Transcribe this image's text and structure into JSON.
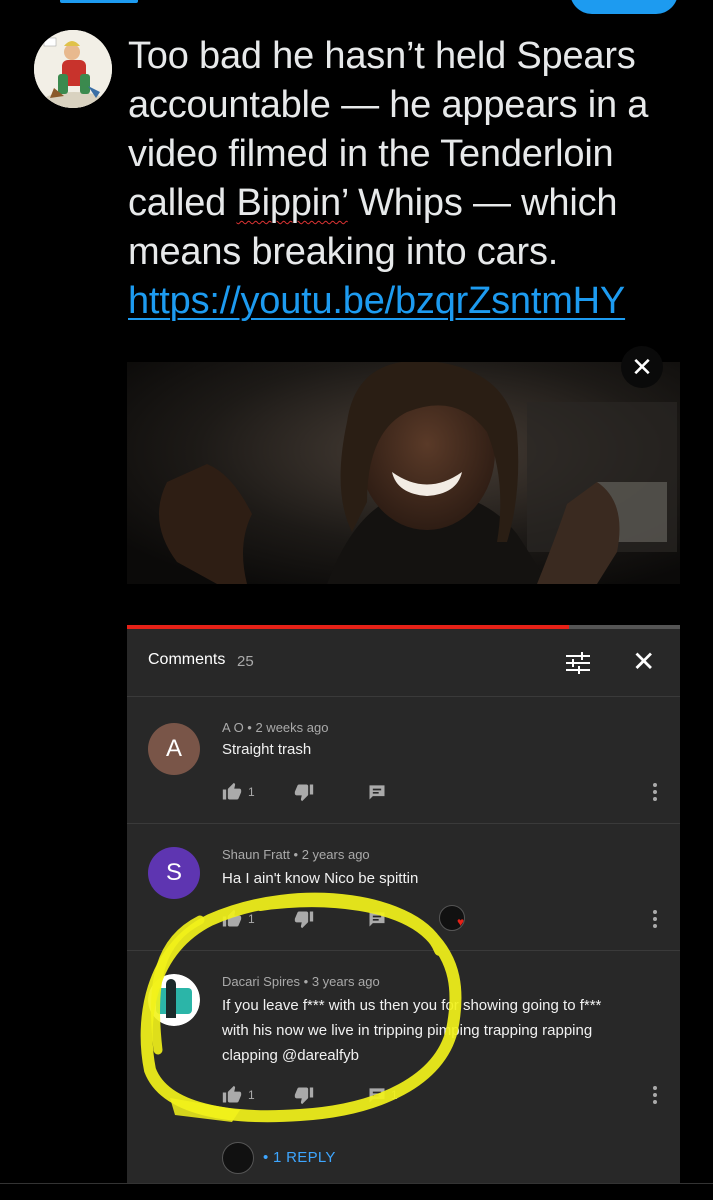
{
  "tweet": {
    "text_line1": "Too bad he hasn’t held Spears",
    "text_line2": "accountable — he appears in a",
    "text_line3": "video filmed in the Tenderloin",
    "text_line4_pre": "called ",
    "text_line4_word": "Bippin’",
    "text_line4_post": " Whips — which",
    "text_line5": "means breaking into cars.",
    "link_text": "https://youtu.be/bzqrZsntmHY"
  },
  "video": {
    "close_label": "✕",
    "progress_fraction": 0.8
  },
  "comments_panel": {
    "title": "Comments",
    "count": "25",
    "close_label": "✕",
    "comments": [
      {
        "avatar_letter": "A",
        "avatar_color": "#795548",
        "author": "A O",
        "time": "2 weeks ago",
        "text": "Straight trash",
        "likes": "1"
      },
      {
        "avatar_letter": "S",
        "avatar_color": "#5e35b1",
        "author": "Shaun Fratt",
        "time": "2 years ago",
        "text": "Ha I ain't know Nico be spittin",
        "likes": "1"
      },
      {
        "author": "Dacari Spires",
        "time": "3 years ago",
        "text_line1": "If you leave f*** with us then you for showing going to f***",
        "text_line2": "with his now we live in tripping pimping trapping rapping",
        "text_line3": "clapping @darealfyb",
        "likes": "1",
        "reply_count": "1",
        "replies_label": "1 REPLY"
      }
    ]
  },
  "colors": {
    "accent": "#1d9bf0",
    "progress": "#e62117",
    "highlight": "#f2f21a",
    "panel": "#282828"
  }
}
